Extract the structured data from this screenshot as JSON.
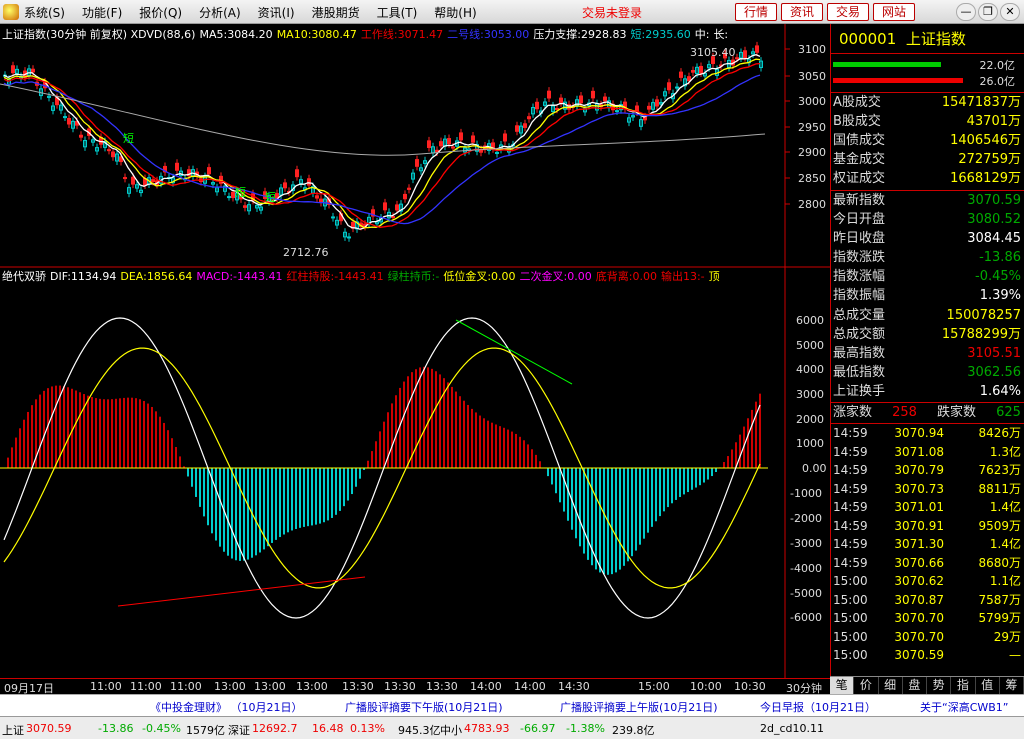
{
  "menu": {
    "items": [
      "系统(S)",
      "功能(F)",
      "报价(Q)",
      "分析(A)",
      "资讯(I)",
      "港股期货",
      "工具(T)",
      "帮助(H)"
    ],
    "status": "交易未登录",
    "buttons": [
      "行情",
      "资讯",
      "交易",
      "网站"
    ]
  },
  "upper": {
    "name": "上证指数(30分钟 前复权) XDVD(88,6)",
    "ma5": "MA5:3084.20",
    "ma10": "MA10:3080.47",
    "l1": "工作线:3071.47",
    "l2": "二号线:3053.00",
    "l3": "压力支撑:2928.83",
    "l4": "短:2935.60",
    "l5": "中:",
    "l6": "长:",
    "hi": "3105.40",
    "lo": "2712.76",
    "marks": [
      "短",
      "短",
      "短"
    ]
  },
  "lower": {
    "name": "绝代双骄",
    "dif": "DIF:1134.94",
    "dea": "DEA:1856.64",
    "macd": "MACD:-1443.41",
    "h": "红柱持股:-1443.41",
    "g": "绿柱持币:-",
    "d": "低位金叉:0.00",
    "e": "二次金叉:0.00",
    "f": "底背离:0.00",
    "o": "输出13:-",
    "j": "顶"
  },
  "yaxis_top": [
    "3100",
    "3050",
    "3000",
    "2950",
    "2900",
    "2850",
    "2800"
  ],
  "yaxis_bot": [
    "6000",
    "5000",
    "4000",
    "3000",
    "2000",
    "1000",
    "0.00",
    "-1000",
    "-2000",
    "-3000",
    "-4000",
    "-5000",
    "-6000"
  ],
  "xaxis": [
    "09月17日",
    "11:00",
    "11:00",
    "11:00",
    "13:00",
    "13:00",
    "13:00",
    "13:30",
    "13:30",
    "13:30",
    "14:00",
    "14:00",
    "14:30",
    "15:00",
    "10:00",
    "10:30",
    "30分钟"
  ],
  "right": {
    "code": "000001",
    "name": "上证指数",
    "vol_up": "22.0亿",
    "vol_down": "26.0亿",
    "stats": [
      {
        "k": "A股成交",
        "v": "15471837万"
      },
      {
        "k": "B股成交",
        "v": "43701万"
      },
      {
        "k": "国债成交",
        "v": "1406546万"
      },
      {
        "k": "基金成交",
        "v": "272759万"
      },
      {
        "k": "权证成交",
        "v": "1668129万"
      }
    ],
    "quote": [
      {
        "k": "最新指数",
        "v": "3070.59",
        "c": "grn"
      },
      {
        "k": "今日开盘",
        "v": "3080.52",
        "c": "grn"
      },
      {
        "k": "昨日收盘",
        "v": "3084.45",
        "c": "wht"
      },
      {
        "k": "指数涨跌",
        "v": "-13.86",
        "c": "grn"
      },
      {
        "k": "指数涨幅",
        "v": "-0.45%",
        "c": "grn"
      },
      {
        "k": "指数振幅",
        "v": "1.39%",
        "c": "wht"
      },
      {
        "k": "总成交量",
        "v": "150078257",
        "c": "yel"
      },
      {
        "k": "总成交额",
        "v": "15788299万",
        "c": "yel"
      },
      {
        "k": "最高指数",
        "v": "3105.51",
        "c": "red"
      },
      {
        "k": "最低指数",
        "v": "3062.56",
        "c": "grn"
      },
      {
        "k": "上证换手",
        "v": "1.64%",
        "c": "wht"
      }
    ],
    "adv_label": "涨家数",
    "adv": "258",
    "dec_label": "跌家数",
    "dec": "625",
    "ticks": [
      {
        "t": "14:59",
        "p": "3070.94",
        "q": "8426万"
      },
      {
        "t": "14:59",
        "p": "3071.08",
        "q": "1.3亿"
      },
      {
        "t": "14:59",
        "p": "3070.79",
        "q": "7623万"
      },
      {
        "t": "14:59",
        "p": "3070.73",
        "q": "8811万"
      },
      {
        "t": "14:59",
        "p": "3071.01",
        "q": "1.4亿"
      },
      {
        "t": "14:59",
        "p": "3070.91",
        "q": "9509万"
      },
      {
        "t": "14:59",
        "p": "3071.30",
        "q": "1.4亿"
      },
      {
        "t": "14:59",
        "p": "3070.66",
        "q": "8680万"
      },
      {
        "t": "15:00",
        "p": "3070.62",
        "q": "1.1亿"
      },
      {
        "t": "15:00",
        "p": "3070.87",
        "q": "7587万"
      },
      {
        "t": "15:00",
        "p": "3070.70",
        "q": "5799万"
      },
      {
        "t": "15:00",
        "p": "3070.70",
        "q": "29万"
      },
      {
        "t": "15:00",
        "p": "3070.59",
        "q": "—"
      }
    ],
    "tabs": [
      "笔",
      "价",
      "细",
      "盘",
      "势",
      "指",
      "值",
      "筹"
    ]
  },
  "news": [
    "《中投金理财》 （10月21日）",
    "广播股评摘要下午版(10月21日)",
    "广播股评摘要上午版(10月21日)",
    "今日早报（10月21日）",
    "关于“深高CWB1”"
  ],
  "status": {
    "sh_label": "上证",
    "sh": "3070.59",
    "sh_chg": "-13.86",
    "sh_pct": "-0.45%",
    "sh_amt": "1579亿",
    "sz_label": "深证",
    "sz": "12692.7",
    "sz_chg": "16.48",
    "sz_pct": "0.13%",
    "sz_amt": "945.3亿",
    "zx_label": "中小",
    "zx": "4783.93",
    "zx_chg": "-66.97",
    "zx_pct": "-1.38%",
    "zx_amt": "239.8亿",
    "ver": "2d_cd10.11"
  }
}
